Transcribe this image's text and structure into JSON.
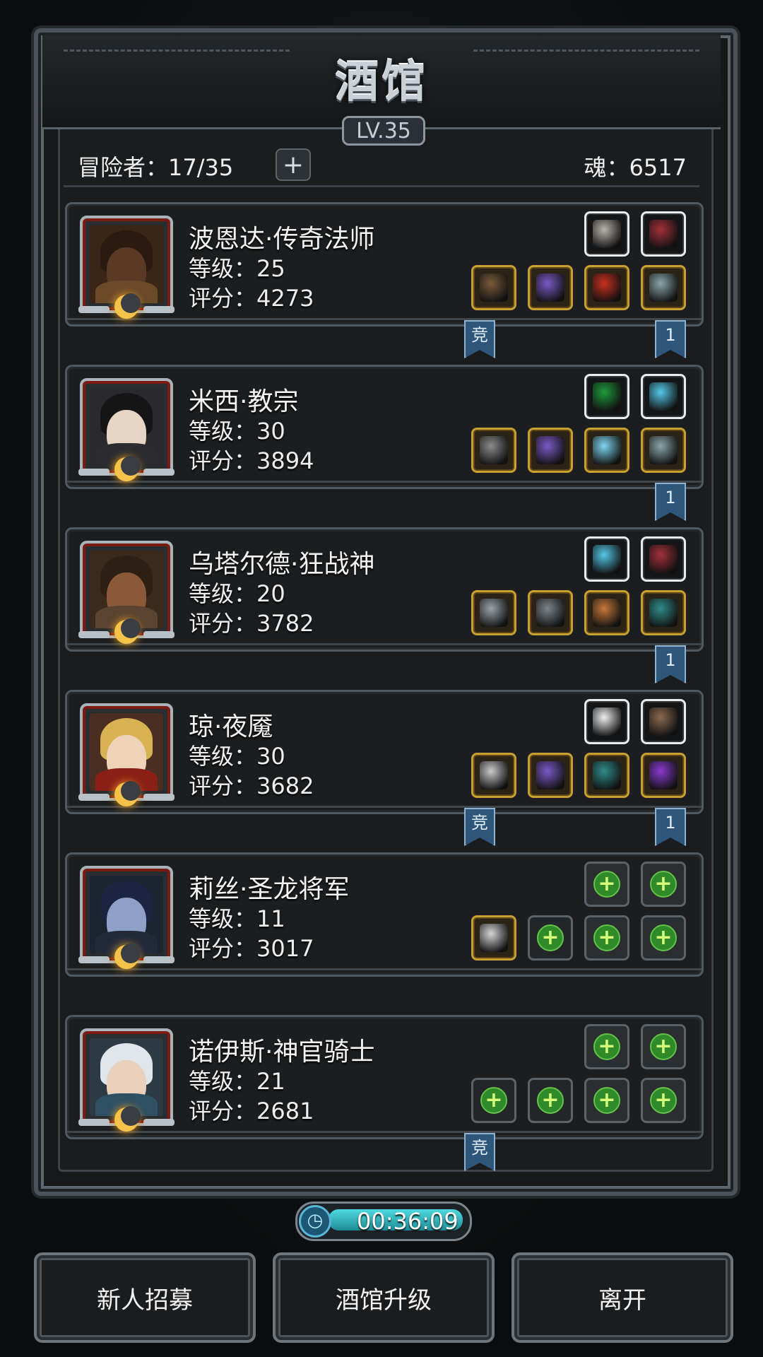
{
  "header": {
    "title": "酒馆",
    "level": "LV.35",
    "adventurers_text": "冒险者：17/35",
    "add_label": "+",
    "soul_text": "魂：6517"
  },
  "heroes": [
    {
      "name": "波恩达·传奇法师",
      "level_text": "等级：25",
      "score_text": "评分：4273",
      "ribbons": [
        {
          "label": "竞"
        },
        {
          "label": "1"
        }
      ],
      "top_slots": [
        {
          "type": "white",
          "icon": "feather-icon"
        },
        {
          "type": "white",
          "icon": "crimson-pouch-icon"
        }
      ],
      "bottom_slots": [
        {
          "type": "gold",
          "icon": "staff-icon"
        },
        {
          "type": "gold",
          "icon": "violet-armor-icon"
        },
        {
          "type": "gold",
          "icon": "flame-helm-icon"
        },
        {
          "type": "gold",
          "icon": "gauntlet-icon"
        }
      ]
    },
    {
      "name": "米西·教宗",
      "level_text": "等级：30",
      "score_text": "评分：3894",
      "ribbons": [
        {
          "label": "1"
        }
      ],
      "top_slots": [
        {
          "type": "white",
          "icon": "green-tome-icon"
        },
        {
          "type": "white",
          "icon": "ice-boot-icon"
        }
      ],
      "bottom_slots": [
        {
          "type": "gold",
          "icon": "hammer-icon"
        },
        {
          "type": "gold",
          "icon": "violet-armor-icon"
        },
        {
          "type": "gold",
          "icon": "ice-ring-icon"
        },
        {
          "type": "gold",
          "icon": "gauntlet-icon"
        }
      ]
    },
    {
      "name": "乌塔尔德·狂战神",
      "level_text": "等级：20",
      "score_text": "评分：3782",
      "ribbons": [
        {
          "label": "1"
        }
      ],
      "top_slots": [
        {
          "type": "white",
          "icon": "ice-boot-icon"
        },
        {
          "type": "white",
          "icon": "crimson-pouch-icon"
        }
      ],
      "bottom_slots": [
        {
          "type": "gold",
          "icon": "axe-icon"
        },
        {
          "type": "gold",
          "icon": "iron-armor-icon"
        },
        {
          "type": "gold",
          "icon": "bronze-ring-icon"
        },
        {
          "type": "gold",
          "icon": "teal-ring-icon"
        }
      ]
    },
    {
      "name": "琼·夜魇",
      "level_text": "等级：30",
      "score_text": "评分：3682",
      "ribbons": [
        {
          "label": "竞"
        },
        {
          "label": "1"
        }
      ],
      "top_slots": [
        {
          "type": "white",
          "icon": "wing-icon"
        },
        {
          "type": "white",
          "icon": "brown-cloak-icon"
        }
      ],
      "bottom_slots": [
        {
          "type": "gold",
          "icon": "blade-icon"
        },
        {
          "type": "gold",
          "icon": "violet-armor-icon"
        },
        {
          "type": "gold",
          "icon": "teal-ring-icon"
        },
        {
          "type": "gold",
          "icon": "purple-ring-icon"
        }
      ]
    },
    {
      "name": "莉丝·圣龙将军",
      "level_text": "等级：11",
      "score_text": "评分：3017",
      "ribbons": [],
      "top_slots": [
        {
          "type": "empty",
          "icon": "add-icon"
        },
        {
          "type": "empty",
          "icon": "add-icon"
        }
      ],
      "bottom_slots": [
        {
          "type": "gold",
          "icon": "sword-icon"
        },
        {
          "type": "empty-dark",
          "icon": "add-icon"
        },
        {
          "type": "empty",
          "icon": "add-icon"
        },
        {
          "type": "empty",
          "icon": "add-icon"
        }
      ]
    },
    {
      "name": "诺伊斯·神官骑士",
      "level_text": "等级：21",
      "score_text": "评分：2681",
      "ribbons": [
        {
          "label": "竞"
        }
      ],
      "top_slots": [
        {
          "type": "empty",
          "icon": "add-icon"
        },
        {
          "type": "empty",
          "icon": "add-icon"
        }
      ],
      "bottom_slots": [
        {
          "type": "empty-dark",
          "icon": "add-icon"
        },
        {
          "type": "empty-dark",
          "icon": "add-icon"
        },
        {
          "type": "empty",
          "icon": "add-icon"
        },
        {
          "type": "empty",
          "icon": "add-icon"
        }
      ]
    }
  ],
  "timer": "00:36:09",
  "buttons": {
    "recruit": "新人招募",
    "upgrade": "酒馆升级",
    "leave": "离开"
  },
  "colors": {
    "gold_border": "#c8a032",
    "ribbon_blue": "#2e557a",
    "plus_green": "#2f8a2a",
    "timer_cyan": "#4fd9e0"
  }
}
